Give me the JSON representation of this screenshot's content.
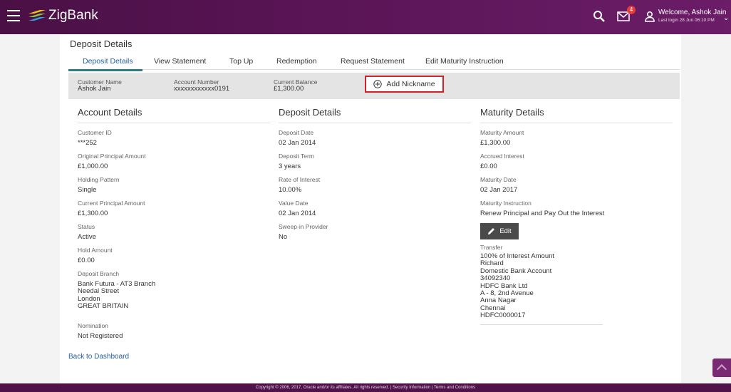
{
  "header": {
    "app_name": "ZigBank",
    "notification_count": "4",
    "welcome": "Welcome, Ashok Jain",
    "last_login": "Last login 28 Jun 06:10 PM"
  },
  "page": {
    "title": "Deposit Details"
  },
  "tabs": [
    "Deposit Details",
    "View Statement",
    "Top Up",
    "Redemption",
    "Request Statement",
    "Edit Maturity Instruction"
  ],
  "summary": {
    "customer_name_label": "Customer Name",
    "customer_name": "Ashok Jain",
    "account_number_label": "Account Number",
    "account_number": "xxxxxxxxxxxx0191",
    "current_balance_label": "Current Balance",
    "current_balance": "£1,300.00",
    "add_nickname": "Add Nickname"
  },
  "account_details": {
    "title": "Account Details",
    "fields": [
      {
        "label": "Customer ID",
        "value": "***252"
      },
      {
        "label": "Original Principal Amount",
        "value": "£1,000.00"
      },
      {
        "label": "Holding Pattern",
        "value": "Single"
      },
      {
        "label": "Current Principal Amount",
        "value": "£1,300.00"
      },
      {
        "label": "Status",
        "value": "Active"
      },
      {
        "label": "Hold Amount",
        "value": "£0.00"
      }
    ],
    "branch_label": "Deposit Branch",
    "branch_lines": [
      "Bank Futura - AT3 Branch",
      "Needal Street",
      "London",
      "GREAT BRITAIN"
    ],
    "nomination_label": "Nomination",
    "nomination_value": "Not Registered"
  },
  "deposit_details": {
    "title": "Deposit Details",
    "fields": [
      {
        "label": "Deposit Date",
        "value": "02 Jan 2014"
      },
      {
        "label": "Deposit Term",
        "value": "3 years"
      },
      {
        "label": "Rate of Interest",
        "value": "10.00%"
      },
      {
        "label": "Value Date",
        "value": "02 Jan 2014"
      },
      {
        "label": "Sweep-in Provider",
        "value": "No"
      }
    ]
  },
  "maturity_details": {
    "title": "Maturity Details",
    "fields": [
      {
        "label": "Maturity Amount",
        "value": "£1,300.00"
      },
      {
        "label": "Accrued Interest",
        "value": "£0.00"
      },
      {
        "label": "Maturity Date",
        "value": "02 Jan 2017"
      },
      {
        "label": "Maturity Instruction",
        "value": "Renew Principal and Pay Out the Interest"
      }
    ],
    "edit_label": "Edit",
    "transfer_label": "Transfer",
    "transfer_lines": [
      "100% of Interest Amount",
      "Richard",
      "Domestic Bank Account",
      "34092340",
      "HDFC Bank Ltd",
      "A - 8, 2nd Avenue",
      "Anna Nagar",
      "Chennai",
      "HDFC0000017"
    ]
  },
  "back_link": "Back to Dashboard",
  "footer": "Copyright © 2006, 2017, Oracle and/or its affiliates. All rights reserved. | Security Information | Terms and Conditions",
  "colors": {
    "header": "#5a1556",
    "accent": "#2a7b8c",
    "highlight": "#d31f2a",
    "link": "#235e9f"
  }
}
